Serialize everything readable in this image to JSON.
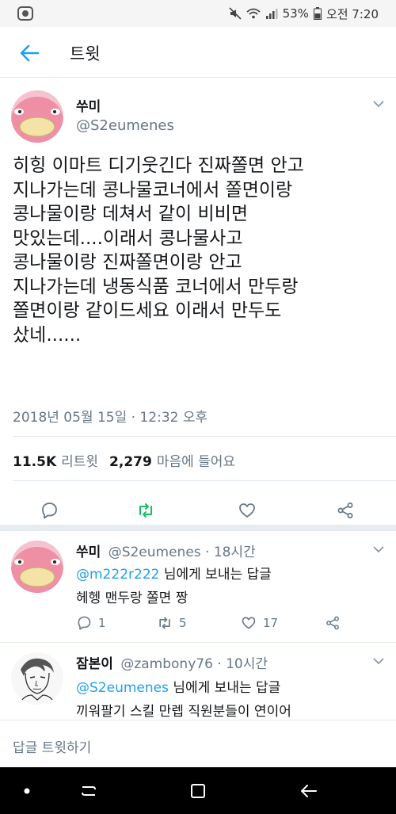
{
  "status_bar": {
    "battery": "53%",
    "time": "오전 7:20"
  },
  "header": {
    "title": "트윗"
  },
  "main_tweet": {
    "display_name": "쑤미",
    "handle": "@S2eumenes",
    "text_lines": [
      "히힝 이마트 디기웃긴다 진짜쫄면 안고",
      "지나가는데 콩나물코너에서 쫄면이랑",
      "콩나물이랑 데쳐서 같이 비비면",
      "맛있는데....이래서 콩나물사고",
      "콩나물이랑 진짜쫄면이랑 안고",
      "지나가는데 냉동식품 코너에서 만두랑",
      "쫄면이랑 같이드세요 이래서 만두도",
      "샀네......"
    ],
    "timestamp": "2018년 05월 15일 · 12:32 오후",
    "retweet_count": "11.5K",
    "retweet_label": "리트윗",
    "like_count": "2,279",
    "like_label": "마음에 들어요"
  },
  "replies": [
    {
      "display_name": "쑤미",
      "handle_time": "@S2eumenes · 18시간",
      "reply_to_mention": "@m222r222",
      "reply_to_suffix": " 님에게 보내는 답글",
      "text": "헤헹 맨두랑 쫄면 짱",
      "reply_count": "1",
      "retweet_count": "5",
      "like_count": "17"
    },
    {
      "display_name": "잠본이",
      "handle_time": "@zambony76 · 10시간",
      "reply_to_mention": "@S2eumenes",
      "reply_to_suffix": " 님에게 보내는 답글",
      "text": "끼워팔기 스킬 만렙 직원분들이 연이어"
    }
  ],
  "compose": {
    "placeholder": "답글 트윗하기"
  },
  "colors": {
    "accent": "#1da1f2",
    "retweet_green": "#17bf63",
    "secondary_text": "#657786",
    "divider": "#e1e8ed"
  },
  "icons": {
    "status_left": "app-notification-icon",
    "back": "arrow-left-icon",
    "caret": "chevron-down-icon",
    "reply": "reply-bubble-icon",
    "retweet": "retweet-icon",
    "like": "heart-icon",
    "share": "share-icon"
  }
}
